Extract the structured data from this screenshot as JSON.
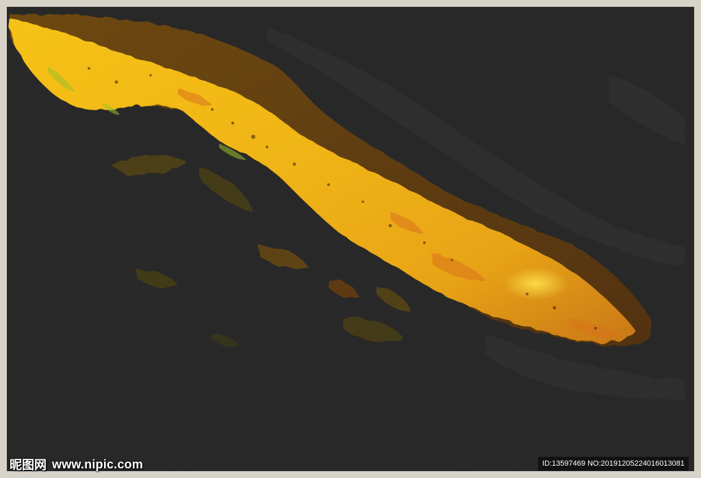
{
  "artwork": {
    "background_color": "#232323",
    "frame_color": "#d8d3c8",
    "accent_gold": "#f2b705",
    "accent_orange": "#d98a12",
    "accent_brown": "#6b4712"
  },
  "watermark": {
    "brand": "昵图网",
    "site": "www.nipic.com",
    "id_text": "ID:13597469 NO:20191205224016013081"
  }
}
